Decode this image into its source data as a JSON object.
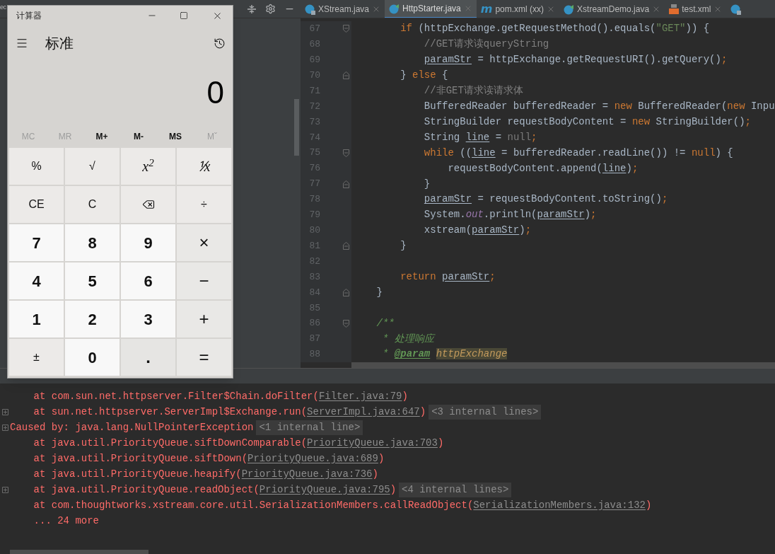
{
  "ide": {
    "toolbar_text": "ec",
    "tabs": [
      {
        "label": "XStream.java",
        "kind": "class-locked",
        "selected": false
      },
      {
        "label": "HttpStarter.java",
        "kind": "runnable",
        "selected": true
      },
      {
        "label": "pom.xml (xx)",
        "kind": "maven",
        "icon_text": "m",
        "selected": false
      },
      {
        "label": "XstreamDemo.java",
        "kind": "runnable",
        "selected": false
      },
      {
        "label": "test.xml",
        "kind": "xml",
        "selected": false
      },
      {
        "kind": "class-locked",
        "selected": false
      }
    ],
    "editor": {
      "lines": [
        {
          "number": "67",
          "fold_start": true,
          "fold_end": false,
          "tokens": [
            {
              "kind": "keyword",
              "text": "        if "
            },
            {
              "kind": "plain",
              "text": "(httpExchange.getRequestMethod().equals("
            },
            {
              "kind": "string",
              "text": "\"GET\""
            },
            {
              "kind": "plain",
              "text": ")) {"
            }
          ]
        },
        {
          "number": "68",
          "fold_start": false,
          "fold_end": false,
          "tokens": [
            {
              "kind": "comment",
              "text": "            //GET请求读queryString"
            }
          ]
        },
        {
          "number": "69",
          "fold_start": false,
          "fold_end": false,
          "tokens": [
            {
              "kind": "variable",
              "text": "            paramStr"
            },
            {
              "kind": "plain",
              "text": " = httpExchange.getRequestURI().getQuery()"
            },
            {
              "kind": "keyword",
              "text": ";"
            }
          ]
        },
        {
          "number": "70",
          "fold_start": false,
          "fold_end": true,
          "tokens": [
            {
              "kind": "plain",
              "text": "        } "
            },
            {
              "kind": "keyword",
              "text": "else "
            },
            {
              "kind": "plain",
              "text": "{"
            }
          ]
        },
        {
          "number": "71",
          "fold_start": false,
          "fold_end": false,
          "tokens": [
            {
              "kind": "comment",
              "text": "            //非GET请求读请求体"
            }
          ]
        },
        {
          "number": "72",
          "fold_start": false,
          "fold_end": false,
          "tokens": [
            {
              "kind": "plain",
              "text": "            BufferedReader bufferedReader = "
            },
            {
              "kind": "keyword",
              "text": "new "
            },
            {
              "kind": "plain",
              "text": "BufferedReader("
            },
            {
              "kind": "keyword",
              "text": "new "
            },
            {
              "kind": "plain",
              "text": "Inpu"
            }
          ]
        },
        {
          "number": "73",
          "fold_start": false,
          "fold_end": false,
          "tokens": [
            {
              "kind": "plain",
              "text": "            StringBuilder requestBodyContent = "
            },
            {
              "kind": "keyword",
              "text": "new "
            },
            {
              "kind": "plain",
              "text": "StringBuilder()"
            },
            {
              "kind": "keyword",
              "text": ";"
            }
          ]
        },
        {
          "number": "74",
          "fold_start": false,
          "fold_end": false,
          "tokens": [
            {
              "kind": "plain",
              "text": "            String "
            },
            {
              "kind": "variable",
              "text": "line"
            },
            {
              "kind": "plain",
              "text": " = "
            },
            {
              "kind": "null",
              "text": "null"
            },
            {
              "kind": "keyword",
              "text": ";"
            }
          ]
        },
        {
          "number": "75",
          "fold_start": true,
          "fold_end": false,
          "tokens": [
            {
              "kind": "keyword",
              "text": "            while "
            },
            {
              "kind": "plain",
              "text": "(("
            },
            {
              "kind": "variable",
              "text": "line"
            },
            {
              "kind": "plain",
              "text": " = bufferedReader.readLine()) != "
            },
            {
              "kind": "keyword",
              "text": "null"
            },
            {
              "kind": "plain",
              "text": ") {"
            }
          ]
        },
        {
          "number": "76",
          "fold_start": false,
          "fold_end": false,
          "tokens": [
            {
              "kind": "plain",
              "text": "                requestBodyContent.append("
            },
            {
              "kind": "variable",
              "text": "line"
            },
            {
              "kind": "plain",
              "text": ")"
            },
            {
              "kind": "keyword",
              "text": ";"
            }
          ]
        },
        {
          "number": "77",
          "fold_start": false,
          "fold_end": true,
          "tokens": [
            {
              "kind": "plain",
              "text": "            }"
            }
          ]
        },
        {
          "number": "78",
          "fold_start": false,
          "fold_end": false,
          "tokens": [
            {
              "kind": "variable",
              "text": "            paramStr"
            },
            {
              "kind": "plain",
              "text": " = requestBodyContent.toString()"
            },
            {
              "kind": "keyword",
              "text": ";"
            }
          ]
        },
        {
          "number": "79",
          "fold_start": false,
          "fold_end": false,
          "tokens": [
            {
              "kind": "plain",
              "text": "            System."
            },
            {
              "kind": "static",
              "text": "out"
            },
            {
              "kind": "plain",
              "text": ".println("
            },
            {
              "kind": "variable",
              "text": "paramStr"
            },
            {
              "kind": "plain",
              "text": ")"
            },
            {
              "kind": "keyword",
              "text": ";"
            }
          ]
        },
        {
          "number": "80",
          "fold_start": false,
          "fold_end": false,
          "tokens": [
            {
              "kind": "plain",
              "text": "            xstream("
            },
            {
              "kind": "variable",
              "text": "paramStr"
            },
            {
              "kind": "plain",
              "text": ")"
            },
            {
              "kind": "keyword",
              "text": ";"
            }
          ]
        },
        {
          "number": "81",
          "fold_start": false,
          "fold_end": true,
          "tokens": [
            {
              "kind": "plain",
              "text": "        }"
            }
          ]
        },
        {
          "number": "82",
          "fold_start": false,
          "fold_end": false
        },
        {
          "number": "83",
          "fold_start": false,
          "fold_end": false,
          "tokens": [
            {
              "kind": "keyword",
              "text": "        return "
            },
            {
              "kind": "variable",
              "text": "paramStr"
            },
            {
              "kind": "keyword",
              "text": ";"
            }
          ]
        },
        {
          "number": "84",
          "fold_start": false,
          "fold_end": true,
          "tokens": [
            {
              "kind": "plain",
              "text": "    }"
            }
          ]
        },
        {
          "number": "85",
          "fold_start": false,
          "fold_end": false
        },
        {
          "number": "86",
          "fold_start": true,
          "fold_end": false,
          "tokens": [
            {
              "kind": "doc",
              "text": "    /**"
            }
          ]
        },
        {
          "number": "87",
          "fold_start": false,
          "fold_end": false,
          "tokens": [
            {
              "kind": "doc",
              "text": "     * 处理响应"
            }
          ]
        },
        {
          "number": "88",
          "fold_start": false,
          "fold_end": false,
          "tokens": [
            {
              "kind": "doc",
              "text": "     * "
            },
            {
              "kind": "doctag",
              "text": "@param "
            },
            {
              "kind": "docparam",
              "text": "httpExchange"
            }
          ]
        }
      ]
    },
    "console": {
      "lines": [
        {
          "expandable": false,
          "parts": [
            {
              "kind": "text",
              "text": "    at com.sun.net.httpserver.Filter$Chain.doFilter("
            },
            {
              "kind": "link",
              "text": "Filter.java:79"
            },
            {
              "kind": "text",
              "text": ")"
            }
          ]
        },
        {
          "expandable": true,
          "parts": [
            {
              "kind": "text",
              "text": "    at sun.net.httpserver.ServerImpl$Exchange.run("
            },
            {
              "kind": "link",
              "text": "ServerImpl.java:647"
            },
            {
              "kind": "text",
              "text": ")"
            },
            {
              "kind": "badge",
              "text": "<3 internal lines>"
            }
          ]
        },
        {
          "expandable": true,
          "parts": [
            {
              "kind": "text",
              "text": "Caused by: java.lang.NullPointerException"
            },
            {
              "kind": "badge",
              "text": "<1 internal line>"
            }
          ]
        },
        {
          "expandable": false,
          "parts": [
            {
              "kind": "text",
              "text": "    at java.util.PriorityQueue.siftDownComparable("
            },
            {
              "kind": "link",
              "text": "PriorityQueue.java:703"
            },
            {
              "kind": "text",
              "text": ")"
            }
          ]
        },
        {
          "expandable": false,
          "parts": [
            {
              "kind": "text",
              "text": "    at java.util.PriorityQueue.siftDown("
            },
            {
              "kind": "link",
              "text": "PriorityQueue.java:689"
            },
            {
              "kind": "text",
              "text": ")"
            }
          ]
        },
        {
          "expandable": false,
          "parts": [
            {
              "kind": "text",
              "text": "    at java.util.PriorityQueue.heapify("
            },
            {
              "kind": "link",
              "text": "PriorityQueue.java:736"
            },
            {
              "kind": "text",
              "text": ")"
            }
          ]
        },
        {
          "expandable": true,
          "parts": [
            {
              "kind": "text",
              "text": "    at java.util.PriorityQueue.readObject("
            },
            {
              "kind": "link",
              "text": "PriorityQueue.java:795"
            },
            {
              "kind": "text",
              "text": ")"
            },
            {
              "kind": "badge",
              "text": "<4 internal lines>"
            }
          ]
        },
        {
          "expandable": false,
          "parts": [
            {
              "kind": "text",
              "text": "    at com.thoughtworks.xstream.core.util.SerializationMembers.callReadObject("
            },
            {
              "kind": "link",
              "text": "SerializationMembers.java:132"
            },
            {
              "kind": "text",
              "text": ")"
            }
          ]
        },
        {
          "expandable": false,
          "parts": [
            {
              "kind": "text",
              "text": "    ... 24 more"
            }
          ]
        }
      ]
    }
  },
  "calculator": {
    "title": "计算器",
    "mode": "标准",
    "display": "0",
    "memory": [
      {
        "label": "MC",
        "disabled": true
      },
      {
        "label": "MR",
        "disabled": true
      },
      {
        "label": "M+",
        "disabled": false
      },
      {
        "label": "M-",
        "disabled": false
      },
      {
        "label": "MS",
        "disabled": false
      },
      {
        "label": "Mˇ",
        "disabled": true
      }
    ],
    "keys": [
      {
        "label": "%",
        "kind": "function"
      },
      {
        "label": "√",
        "kind": "function"
      },
      {
        "label": "x$^{2}$",
        "kind": "math"
      },
      {
        "label": "⅟x",
        "kind": "math"
      },
      {
        "label": "CE",
        "kind": "function"
      },
      {
        "label": "C",
        "kind": "function"
      },
      {
        "kind": "backspace"
      },
      {
        "label": "÷",
        "kind": "function"
      },
      {
        "label": "7",
        "kind": "digit"
      },
      {
        "label": "8",
        "kind": "digit"
      },
      {
        "label": "9",
        "kind": "digit"
      },
      {
        "label": "×",
        "kind": "operator"
      },
      {
        "label": "4",
        "kind": "digit"
      },
      {
        "label": "5",
        "kind": "digit"
      },
      {
        "label": "6",
        "kind": "digit"
      },
      {
        "label": "−",
        "kind": "operator"
      },
      {
        "label": "1",
        "kind": "digit"
      },
      {
        "label": "2",
        "kind": "digit"
      },
      {
        "label": "3",
        "kind": "digit"
      },
      {
        "label": "+",
        "kind": "operator"
      },
      {
        "label": "±",
        "kind": "function"
      },
      {
        "label": "0",
        "kind": "digit"
      },
      {
        "label": ".",
        "kind": "function-bold"
      },
      {
        "label": "=",
        "kind": "operator"
      }
    ]
  }
}
